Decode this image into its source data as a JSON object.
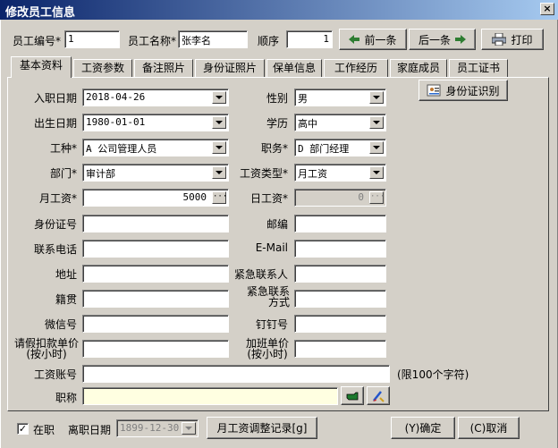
{
  "window": {
    "title": "修改员工信息",
    "close": "×"
  },
  "top": {
    "emp_no_label": "员工编号*",
    "emp_no_value": "1",
    "emp_name_label": "员工名称*",
    "emp_name_value": "张李名",
    "order_label": "顺序",
    "order_value": "1",
    "prev_label": "前一条",
    "next_label": "后一条",
    "print_label": "打印"
  },
  "tabs": [
    "基本资料",
    "工资参数",
    "备注照片",
    "身份证照片",
    "保单信息",
    "工作经历",
    "家庭成员",
    "员工证书"
  ],
  "id_recognize_label": "身份证识别",
  "form": {
    "hire_date_label": "入职日期",
    "hire_date_value": "2018-04-26",
    "gender_label": "性别",
    "gender_value": "男",
    "birth_label": "出生日期",
    "birth_value": "1980-01-01",
    "education_label": "学历",
    "education_value": "高中",
    "worktype_label": "工种*",
    "worktype_value": "A 公司管理人员",
    "position_label": "职务*",
    "position_value": "D 部门经理",
    "dept_label": "部门*",
    "dept_value": "审计部",
    "salary_type_label": "工资类型*",
    "salary_type_value": "月工资",
    "monthly_label": "月工资*",
    "monthly_value": "5000",
    "daily_label": "日工资*",
    "daily_value": "0",
    "idcard_label": "身份证号",
    "postcode_label": "邮编",
    "phone_label": "联系电话",
    "email_label": "E-Mail",
    "address_label": "地址",
    "emergency_label": "紧急联系人",
    "native_label": "籍贯",
    "emergency_contact_label": "紧急联系方式",
    "wechat_label": "微信号",
    "dingtalk_label": "钉钉号",
    "leave_rate_label": "请假扣款单价(按小时)",
    "overtime_rate_label": "加班单价(按小时)",
    "salary_account_label": "工资账号",
    "limit_note": "(限100个字符)",
    "title_label": "职称"
  },
  "bottom": {
    "on_job_label": "在职",
    "leave_date_label": "离职日期",
    "leave_date_value": "1899-12-30",
    "salary_adjust_label": "月工资调整记录[g]",
    "ok_label": "(Y)确定",
    "cancel_label": "(C)取消"
  }
}
